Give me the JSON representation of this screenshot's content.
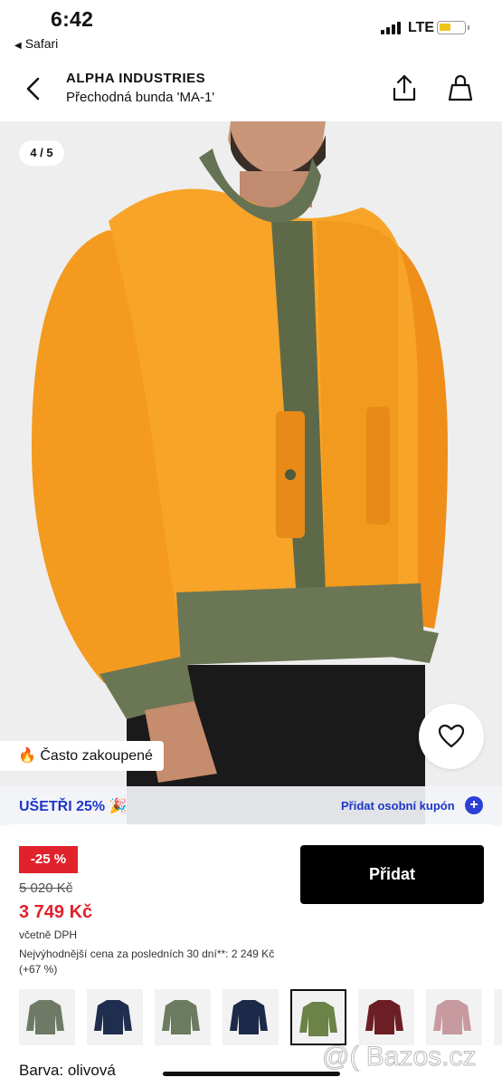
{
  "status_bar": {
    "time": "6:42",
    "back_app": "Safari",
    "network": "LTE",
    "battery_color": "#f0c419"
  },
  "header": {
    "brand": "ALPHA INDUSTRIES",
    "product": "Přechodná bunda 'MA-1'",
    "icons": [
      "back-chevron-icon",
      "share-icon",
      "shopping-bag-icon"
    ]
  },
  "gallery": {
    "counter": "4 / 5",
    "badge_icon": "🔥",
    "badge_text": "Často zakoupené"
  },
  "promo": {
    "save_text": "UŠETŘI 25% 🎉",
    "coupon_text": "Přidat osobní kupón",
    "coupon_icon": "+",
    "accent_color": "#1d36c9"
  },
  "pricing": {
    "discount": "-25 %",
    "old_price": "5 020 Kč",
    "price": "3 749 Kč",
    "vat": "včetně DPH",
    "lowest_price": "Nejvýhodnější cena za posledních 30 dní**: 2 249 Kč (+67 %)",
    "add_button": "Přidat",
    "sale_color": "#e0222d"
  },
  "colors": {
    "label": "Barva: olivová",
    "variants": [
      {
        "name": "olive-gray",
        "color": "#6f7a66"
      },
      {
        "name": "navy",
        "color": "#1f2d4e"
      },
      {
        "name": "sage",
        "color": "#6c7a60"
      },
      {
        "name": "dark-navy",
        "color": "#1b2a48"
      },
      {
        "name": "olive",
        "color": "#6b8347",
        "selected": true
      },
      {
        "name": "maroon",
        "color": "#6b1e24"
      },
      {
        "name": "dusty-pink",
        "color": "#c79aa0"
      }
    ]
  },
  "watermark": "@( Bazos.cz"
}
